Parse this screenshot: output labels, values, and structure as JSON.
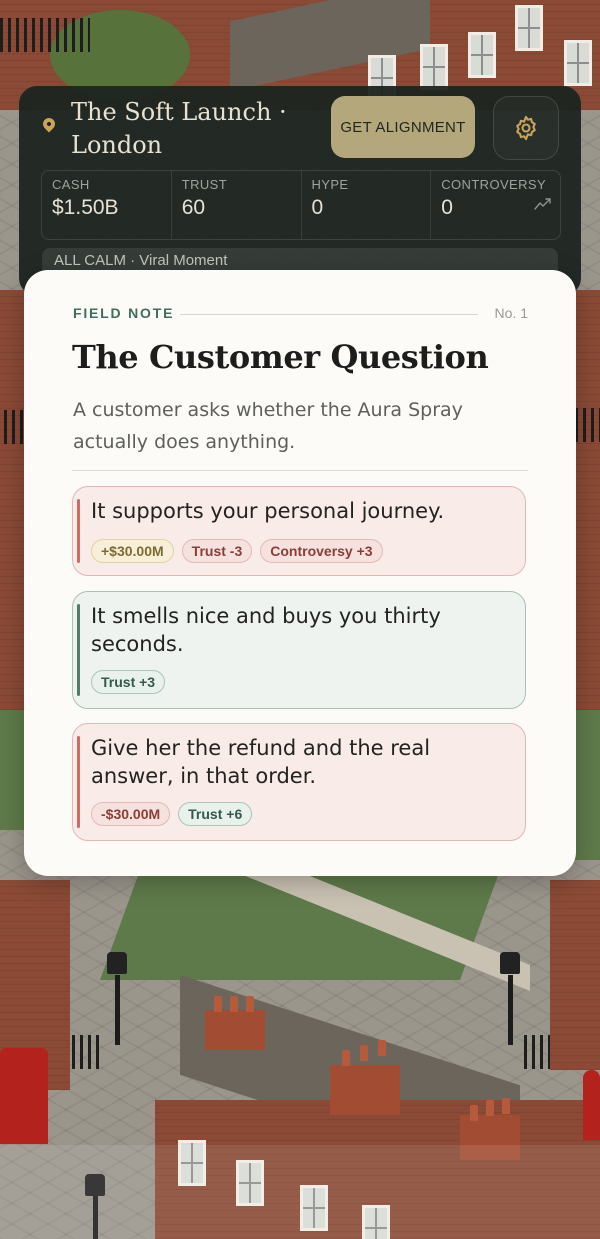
{
  "hud": {
    "title": "The Soft Launch · London",
    "alignment_button": "GET ALIGNMENT",
    "stats": [
      {
        "label": "CASH",
        "value": "$1.50B"
      },
      {
        "label": "TRUST",
        "value": "60"
      },
      {
        "label": "HYPE",
        "value": "0"
      },
      {
        "label": "CONTROVERSY",
        "value": "0"
      }
    ],
    "status": "ALL CALM · Viral Moment"
  },
  "card": {
    "kicker": "FIELD NOTE",
    "number": "No. 1",
    "title": "The Customer Question",
    "description": "A customer asks whether the Aura Spray actually does anything.",
    "choices": [
      {
        "text": "It supports your personal journey.",
        "tags": [
          "+$30.00M",
          "Trust -3",
          "Controversy +3"
        ]
      },
      {
        "text": "It smells nice and buys you thirty seconds.",
        "tags": [
          "Trust +3"
        ]
      },
      {
        "text": "Give her the refund and the real answer, in that order.",
        "tags": [
          "-$30.00M",
          "Trust +6"
        ]
      }
    ]
  },
  "colors": {
    "hud_bg": "#1c2420",
    "accent_gold": "#b5a77c",
    "accent_green": "#3f6e5e",
    "negative_red": "#cf6a63",
    "positive_green": "#4f7e67"
  },
  "icons": {
    "location": "location-pin-icon",
    "settings": "gear-icon",
    "trend": "trend-sparkline-icon"
  }
}
